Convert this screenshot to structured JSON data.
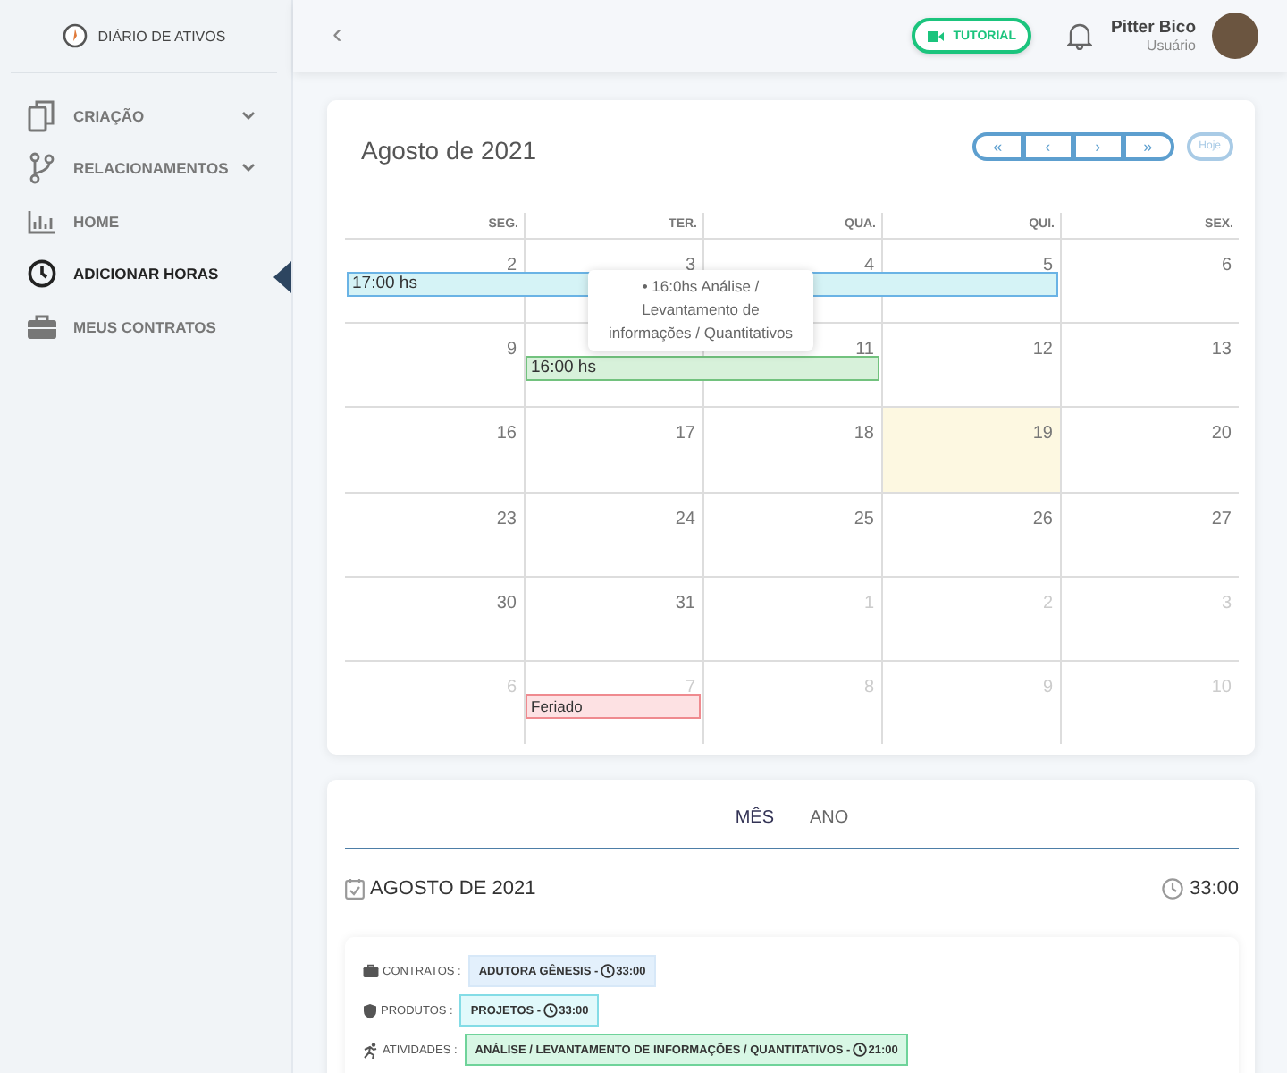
{
  "sidebar": {
    "brand": "DIÁRIO DE ATIVOS",
    "items": [
      {
        "label": "CRIAÇÃO",
        "has_submenu": true,
        "selected": false
      },
      {
        "label": "RELACIONAMENTOS",
        "has_submenu": true,
        "selected": false
      },
      {
        "label": "HOME",
        "has_submenu": false,
        "selected": false
      },
      {
        "label": "ADICIONAR HORAS",
        "has_submenu": false,
        "selected": true
      },
      {
        "label": "MEUS CONTRATOS",
        "has_submenu": false,
        "selected": false
      }
    ]
  },
  "header": {
    "back": "‹",
    "tutorial": "TUTORIAL",
    "user_name": "Pitter Bico",
    "user_role": "Usuário"
  },
  "calendar": {
    "title": "Agosto de 2021",
    "nav": [
      "«",
      "‹",
      "›",
      "»"
    ],
    "today_button": "Hoje",
    "weekdays": [
      "SEG.",
      "TER.",
      "QUA.",
      "QUI.",
      "SEX."
    ],
    "weeks": [
      {
        "days": [
          {
            "day": "2",
            "other_month": false,
            "today": false,
            "event": {
              "label": "17:00 hs",
              "kind": "pending"
            }
          },
          {
            "day": "3",
            "other_month": false,
            "today": false,
            "continues": true
          },
          {
            "day": "4",
            "other_month": false,
            "today": false,
            "continues": true
          },
          {
            "day": "5",
            "other_month": false,
            "today": false,
            "continues": true
          },
          {
            "day": "6",
            "other_month": false,
            "today": false
          }
        ]
      },
      {
        "days": [
          {
            "day": "9",
            "other_month": false,
            "today": false
          },
          {
            "today": false,
            "event": {
              "label": "16:00 hs",
              "kind": "approved"
            }
          },
          {
            "day": "11",
            "other_month": false,
            "today": false,
            "continues": true
          },
          {
            "day": "12",
            "other_month": false,
            "today": false
          },
          {
            "day": "13",
            "other_month": false,
            "today": false
          }
        ]
      },
      {
        "days": [
          {
            "day": "16",
            "other_month": false,
            "today": false
          },
          {
            "day": "17",
            "other_month": false,
            "today": false
          },
          {
            "day": "18",
            "other_month": false,
            "today": false
          },
          {
            "day": "19",
            "other_month": false,
            "today": true
          },
          {
            "day": "20",
            "other_month": false,
            "today": false
          }
        ]
      },
      {
        "days": [
          {
            "day": "23",
            "other_month": false,
            "today": false
          },
          {
            "day": "24",
            "other_month": false,
            "today": false
          },
          {
            "day": "25",
            "other_month": false,
            "today": false
          },
          {
            "day": "26",
            "other_month": false,
            "today": false
          },
          {
            "day": "27",
            "other_month": false,
            "today": false
          }
        ]
      },
      {
        "days": [
          {
            "day": "30",
            "other_month": false,
            "today": false
          },
          {
            "day": "31",
            "other_month": false,
            "today": false
          },
          {
            "day": "1",
            "other_month": true,
            "today": false
          },
          {
            "day": "2",
            "other_month": true,
            "today": false
          },
          {
            "day": "3",
            "other_month": true,
            "today": false
          }
        ]
      },
      {
        "days": [
          {
            "day": "6",
            "other_month": true,
            "today": false
          },
          {
            "day": "7",
            "other_month": true,
            "today": false,
            "event": {
              "label": "Feriado",
              "kind": "holiday"
            }
          },
          {
            "day": "8",
            "other_month": true,
            "today": false
          },
          {
            "day": "9",
            "other_month": true,
            "today": false
          },
          {
            "day": "10",
            "other_month": true,
            "today": false
          }
        ]
      }
    ],
    "tooltip": "• 16:0hs Análise / Levantamento de informações / Quantitativos"
  },
  "summary": {
    "tabs": [
      {
        "label": "MÊS",
        "selected": true
      },
      {
        "label": "ANO",
        "selected": false
      }
    ],
    "period": "AGOSTO DE 2021",
    "total": "33:00",
    "rows": [
      {
        "label": "CONTRATOS :",
        "chips": [
          {
            "text": "ADUTORA GÊNESIS - ",
            "time": "33:00",
            "kind": "contract"
          }
        ]
      },
      {
        "label": "PRODUTOS :",
        "chips": [
          {
            "text": "PROJETOS - ",
            "time": "33:00",
            "kind": "product"
          }
        ]
      },
      {
        "label": "ATIVIDADES :",
        "chips": [
          {
            "text": "ANÁLISE / LEVANTAMENTO DE INFORMAÇÕES / QUANTITATIVOS - ",
            "time": "21:00",
            "kind": "activity"
          }
        ]
      }
    ]
  }
}
